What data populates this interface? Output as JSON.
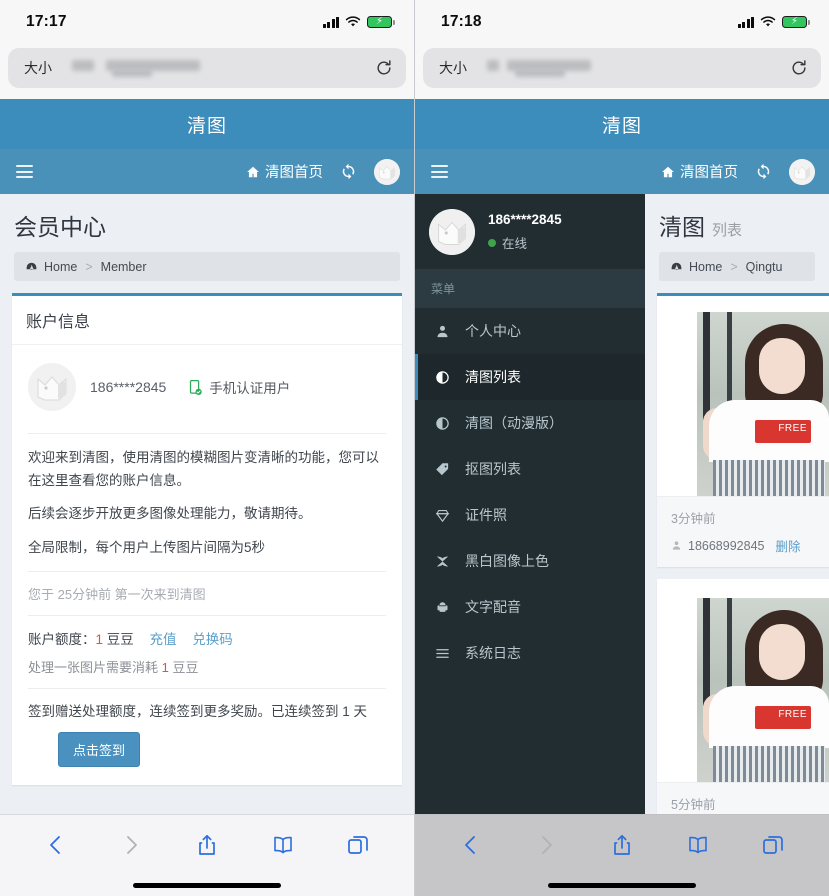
{
  "left_phone": {
    "status": {
      "time": "17:17",
      "signal_icon": "cellular-bars-icon",
      "wifi_icon": "wifi-icon",
      "battery_icon": "battery-charging-icon"
    },
    "browser": {
      "aa_label": "大小",
      "url_value": "",
      "url_redacted": true,
      "reload_icon": "reload-icon"
    },
    "app_header": {
      "title": "清图",
      "menu_icon": "hamburger-icon",
      "home_label": "清图首页",
      "home_icon": "home-icon",
      "refresh_icon": "refresh-icon",
      "avatar_icon": "user-avatar-icon"
    },
    "page": {
      "title": "会员中心",
      "breadcrumb": {
        "icon": "dashboard-icon",
        "home": "Home",
        "separator": ">",
        "current": "Member"
      },
      "card": {
        "header": "账户信息",
        "account": {
          "avatar_icon": "user-avatar-icon",
          "phone": "186****2845",
          "verified_icon": "mobile-verified-icon",
          "verified_label": "手机认证用户"
        },
        "paragraphs": [
          "欢迎来到清图，使用清图的模糊图片变清晰的功能，您可以在这里查看您的账户信息。",
          "后续会逐步开放更多图像处理能力，敬请期待。",
          "全局限制，每个用户上传图片间隔为5秒"
        ],
        "visit_note": "您于 25分钟前 第一次来到清图",
        "quota_label": "账户额度：",
        "quota_value": "1",
        "quota_unit": "豆豆",
        "recharge_link": "充值",
        "redeem_link": "兑换码",
        "cost_prefix": "处理一张图片需要消耗 ",
        "cost_value": "1",
        "cost_unit": " 豆豆",
        "signin_note": "签到赠送处理额度，连续签到更多奖励。已连续签到 1 天",
        "signin_button": "点击签到"
      }
    },
    "toolbar": {
      "back_icon": "chevron-left-icon",
      "forward_icon": "chevron-right-icon",
      "share_icon": "share-icon",
      "bookmarks_icon": "book-icon",
      "tabs_icon": "tabs-icon"
    }
  },
  "right_phone": {
    "status": {
      "time": "17:18",
      "signal_icon": "cellular-bars-icon",
      "wifi_icon": "wifi-icon",
      "battery_icon": "battery-charging-icon"
    },
    "browser": {
      "aa_label": "大小",
      "url_value": "",
      "url_redacted": true,
      "reload_icon": "reload-icon"
    },
    "app_header": {
      "title": "清图",
      "menu_icon": "hamburger-icon",
      "home_label": "清图首页",
      "home_icon": "home-icon",
      "refresh_icon": "refresh-icon",
      "avatar_icon": "user-avatar-icon"
    },
    "sidebar": {
      "user": {
        "avatar_icon": "user-avatar-icon",
        "name": "186****2845",
        "status": "在线",
        "status_color": "#3fa34d"
      },
      "section_label": "菜单",
      "items": [
        {
          "label": "个人中心",
          "icon": "user-icon",
          "active": false
        },
        {
          "label": "清图列表",
          "icon": "contrast-circle-icon",
          "active": true
        },
        {
          "label": "清图（动漫版）",
          "icon": "contrast-circle-icon",
          "active": false
        },
        {
          "label": "抠图列表",
          "icon": "tag-icon",
          "active": false
        },
        {
          "label": "证件照",
          "icon": "diamond-icon",
          "active": false
        },
        {
          "label": "黑白图像上色",
          "icon": "shuriken-icon",
          "active": false
        },
        {
          "label": "文字配音",
          "icon": "android-icon",
          "active": false
        },
        {
          "label": "系统日志",
          "icon": "list-icon",
          "active": false
        }
      ]
    },
    "content": {
      "title": "清图",
      "title_sub": "列表",
      "breadcrumb": {
        "icon": "dashboard-icon",
        "home": "Home",
        "separator": ">",
        "current": "Qingtu"
      },
      "items": [
        {
          "time": "3分钟前",
          "owner_icon": "user-icon",
          "owner": "18668992845",
          "delete_label": "删除",
          "image_alt": "girl-photo-thumbnail"
        },
        {
          "time": "5分钟前",
          "owner_icon": "user-icon",
          "owner": "",
          "delete_label": "",
          "image_alt": "girl-photo-thumbnail"
        }
      ]
    },
    "toolbar": {
      "back_icon": "chevron-left-icon",
      "forward_icon": "chevron-right-icon",
      "share_icon": "share-icon",
      "bookmarks_icon": "book-icon",
      "tabs_icon": "tabs-icon"
    }
  },
  "theme": {
    "accent_blue": "#3c8dbc",
    "nav_blue": "#4a91b9",
    "sidebar_dark": "#222d32",
    "sidebar_active": "#1e282c",
    "page_bg": "#ecf0f5",
    "link_blue": "#5a9ec9",
    "danger_red": "#d9534f",
    "online_green": "#3fa34d",
    "ios_blue": "#2b6fdd"
  }
}
